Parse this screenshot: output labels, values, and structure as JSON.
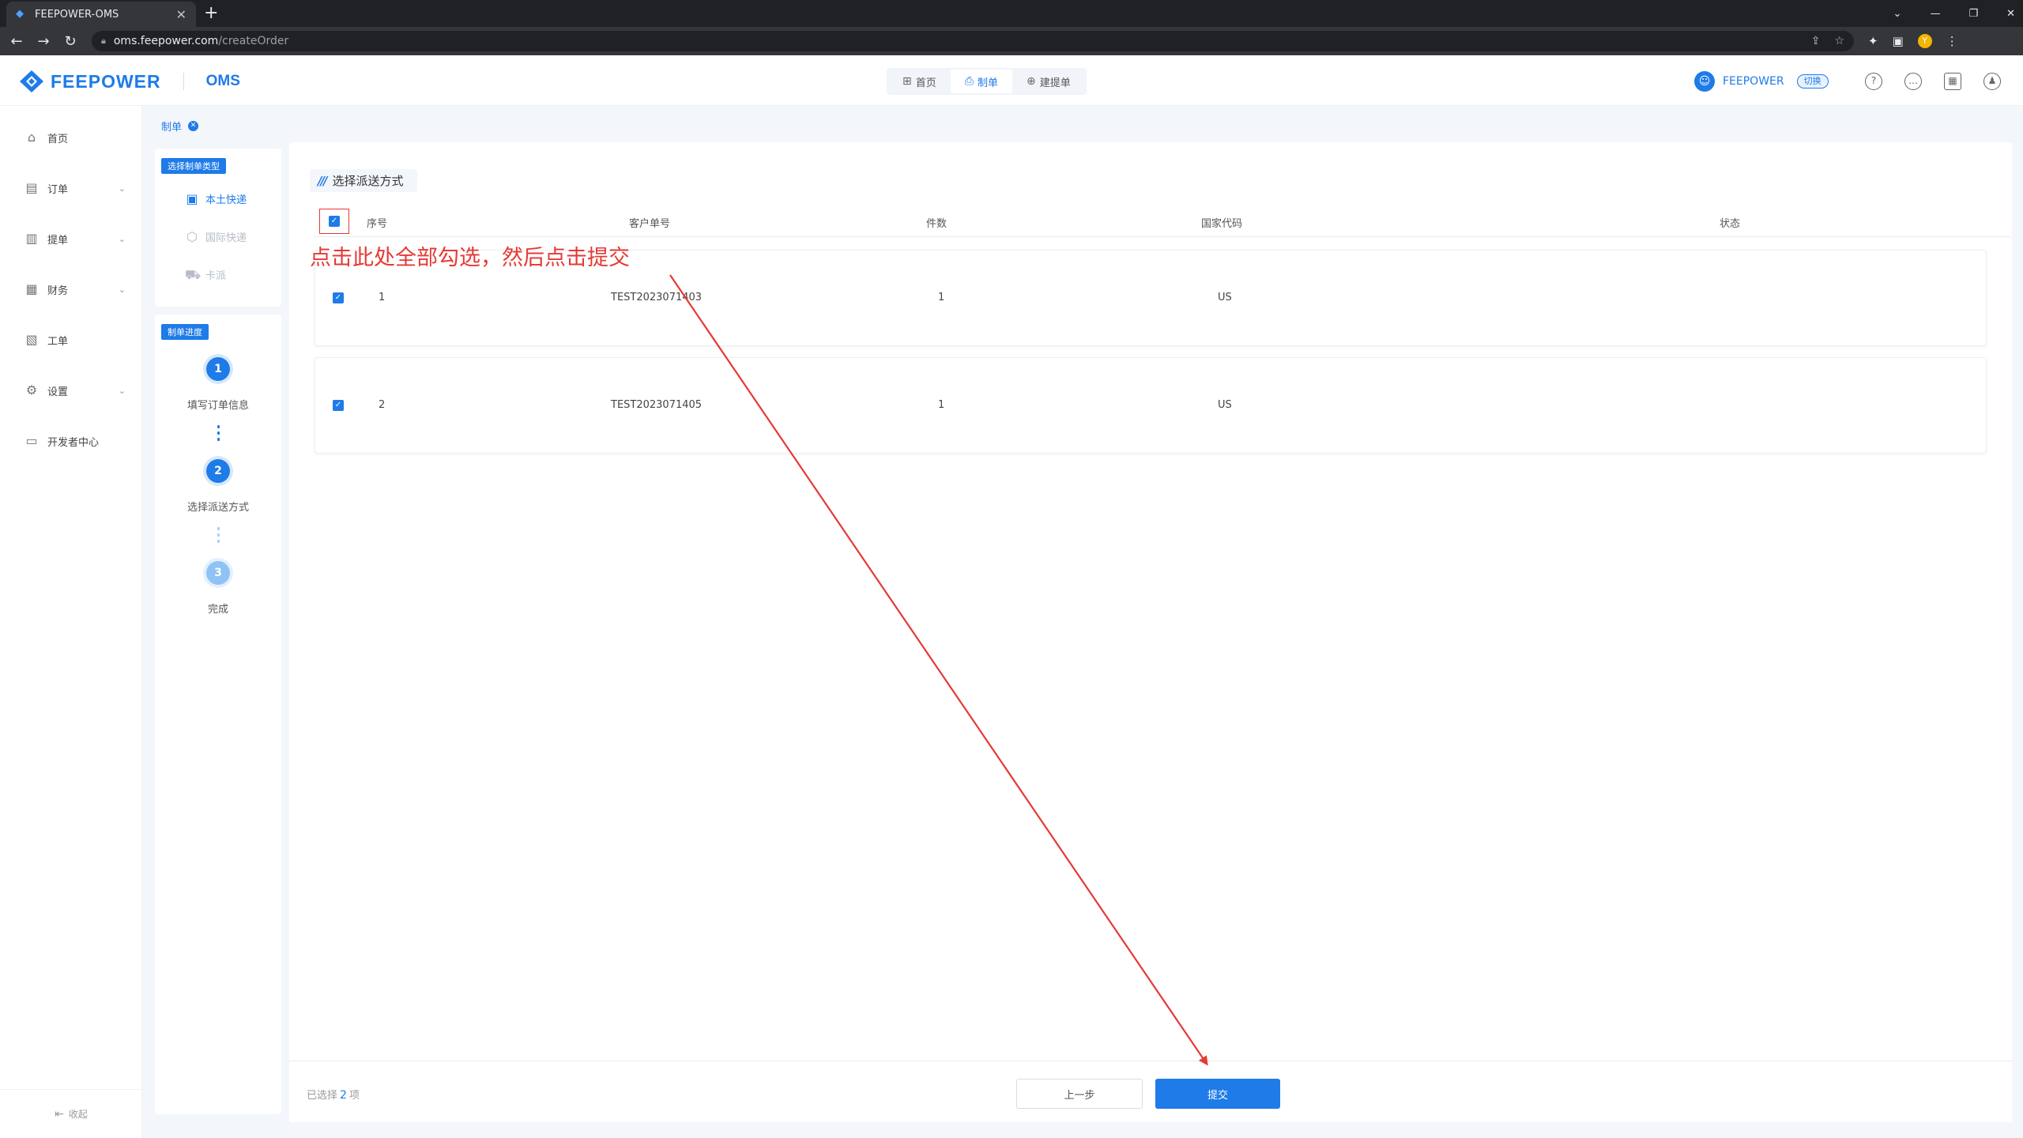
{
  "browser": {
    "tab_title": "FEEPOWER-OMS",
    "tab_close": "✕",
    "new_tab": "+",
    "url_host": "oms.feepower.com",
    "url_path": "/createOrder",
    "window_controls": [
      "⌄",
      "—",
      "❐",
      "✕"
    ]
  },
  "header": {
    "brand": "FEEPOWER",
    "product": "OMS",
    "nav": [
      {
        "label": "首页",
        "icon": "grid-icon"
      },
      {
        "label": "制单",
        "icon": "order-make-icon"
      },
      {
        "label": "建提单",
        "icon": "bill-create-icon"
      }
    ],
    "user_name": "FEEPOWER",
    "switch_label": "切换",
    "icons": [
      "help-icon",
      "message-icon",
      "calendar-icon",
      "user-icon"
    ]
  },
  "sidebar": {
    "items": [
      {
        "label": "首页",
        "icon": "home-icon",
        "has_children": false
      },
      {
        "label": "订单",
        "icon": "order-icon",
        "has_children": true
      },
      {
        "label": "提单",
        "icon": "bill-icon",
        "has_children": true
      },
      {
        "label": "财务",
        "icon": "finance-icon",
        "has_children": true
      },
      {
        "label": "工单",
        "icon": "ticket-icon",
        "has_children": false
      },
      {
        "label": "设置",
        "icon": "settings-icon",
        "has_children": true
      },
      {
        "label": "开发者中心",
        "icon": "developer-icon",
        "has_children": false
      }
    ],
    "collapse_label": "收起"
  },
  "breadcrumb": {
    "label": "制单"
  },
  "order_type": {
    "tag": "选择制单类型",
    "options": [
      {
        "label": "本土快递",
        "state": "active"
      },
      {
        "label": "国际快递",
        "state": "disabled"
      },
      {
        "label": "卡派",
        "state": "disabled"
      }
    ]
  },
  "progress": {
    "tag": "制单进度",
    "steps": [
      {
        "num": "1",
        "label": "填写订单信息",
        "state": "done"
      },
      {
        "num": "2",
        "label": "选择派送方式",
        "state": "done"
      },
      {
        "num": "3",
        "label": "完成",
        "state": "pending"
      }
    ]
  },
  "section": {
    "title": "选择派送方式"
  },
  "table": {
    "columns": [
      "序号",
      "客户单号",
      "件数",
      "国家代码",
      "状态"
    ],
    "rows": [
      {
        "index": "1",
        "customer_no": "TEST2023071403",
        "qty": "1",
        "country": "US",
        "status": "",
        "checked": true
      },
      {
        "index": "2",
        "customer_no": "TEST2023071405",
        "qty": "1",
        "country": "US",
        "status": "",
        "checked": true
      }
    ]
  },
  "annotation": "点击此处全部勾选，然后点击提交",
  "footer": {
    "selected_prefix": "已选择",
    "selected_count": "2",
    "selected_suffix": "项",
    "prev_label": "上一步",
    "submit_label": "提交"
  },
  "colors": {
    "primary": "#1e7be8",
    "annotation_red": "#e53935",
    "step_pending": "#8fc3f5"
  }
}
